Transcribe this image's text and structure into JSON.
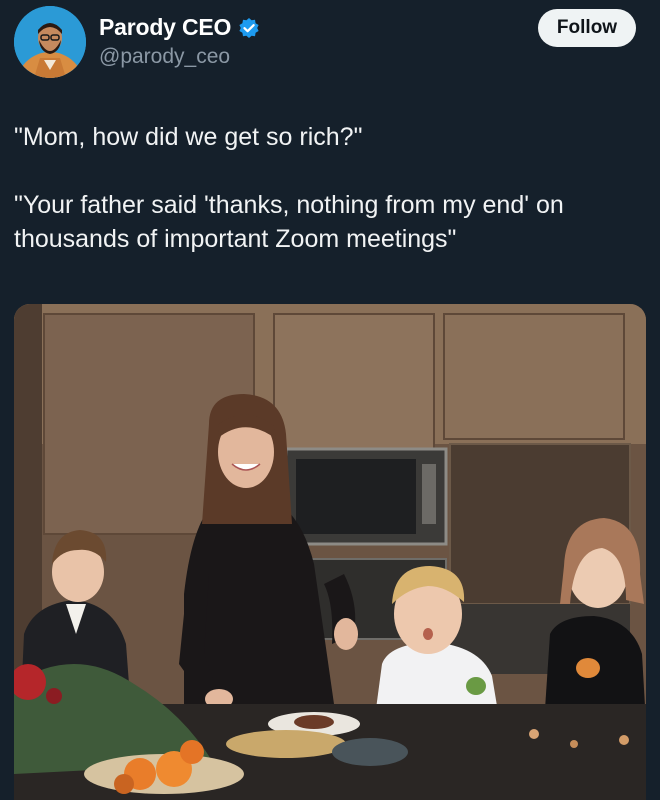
{
  "author": {
    "display_name": "Parody CEO",
    "handle": "@parody_ceo",
    "verified": true,
    "avatar_icon": "bearded-man-avatar-icon",
    "verified_icon": "verified-badge-icon"
  },
  "actions": {
    "follow_label": "Follow"
  },
  "tweet": {
    "line1": "\"Mom, how did we get so rich?\"",
    "line2": "\"Your father said 'thanks, nothing from my end' on",
    "line3": "thousands of important Zoom meetings\""
  },
  "colors": {
    "background": "#15202b",
    "verified": "#1d9bf0",
    "handle": "#8b98a5",
    "follow_bg": "#eff3f4"
  }
}
